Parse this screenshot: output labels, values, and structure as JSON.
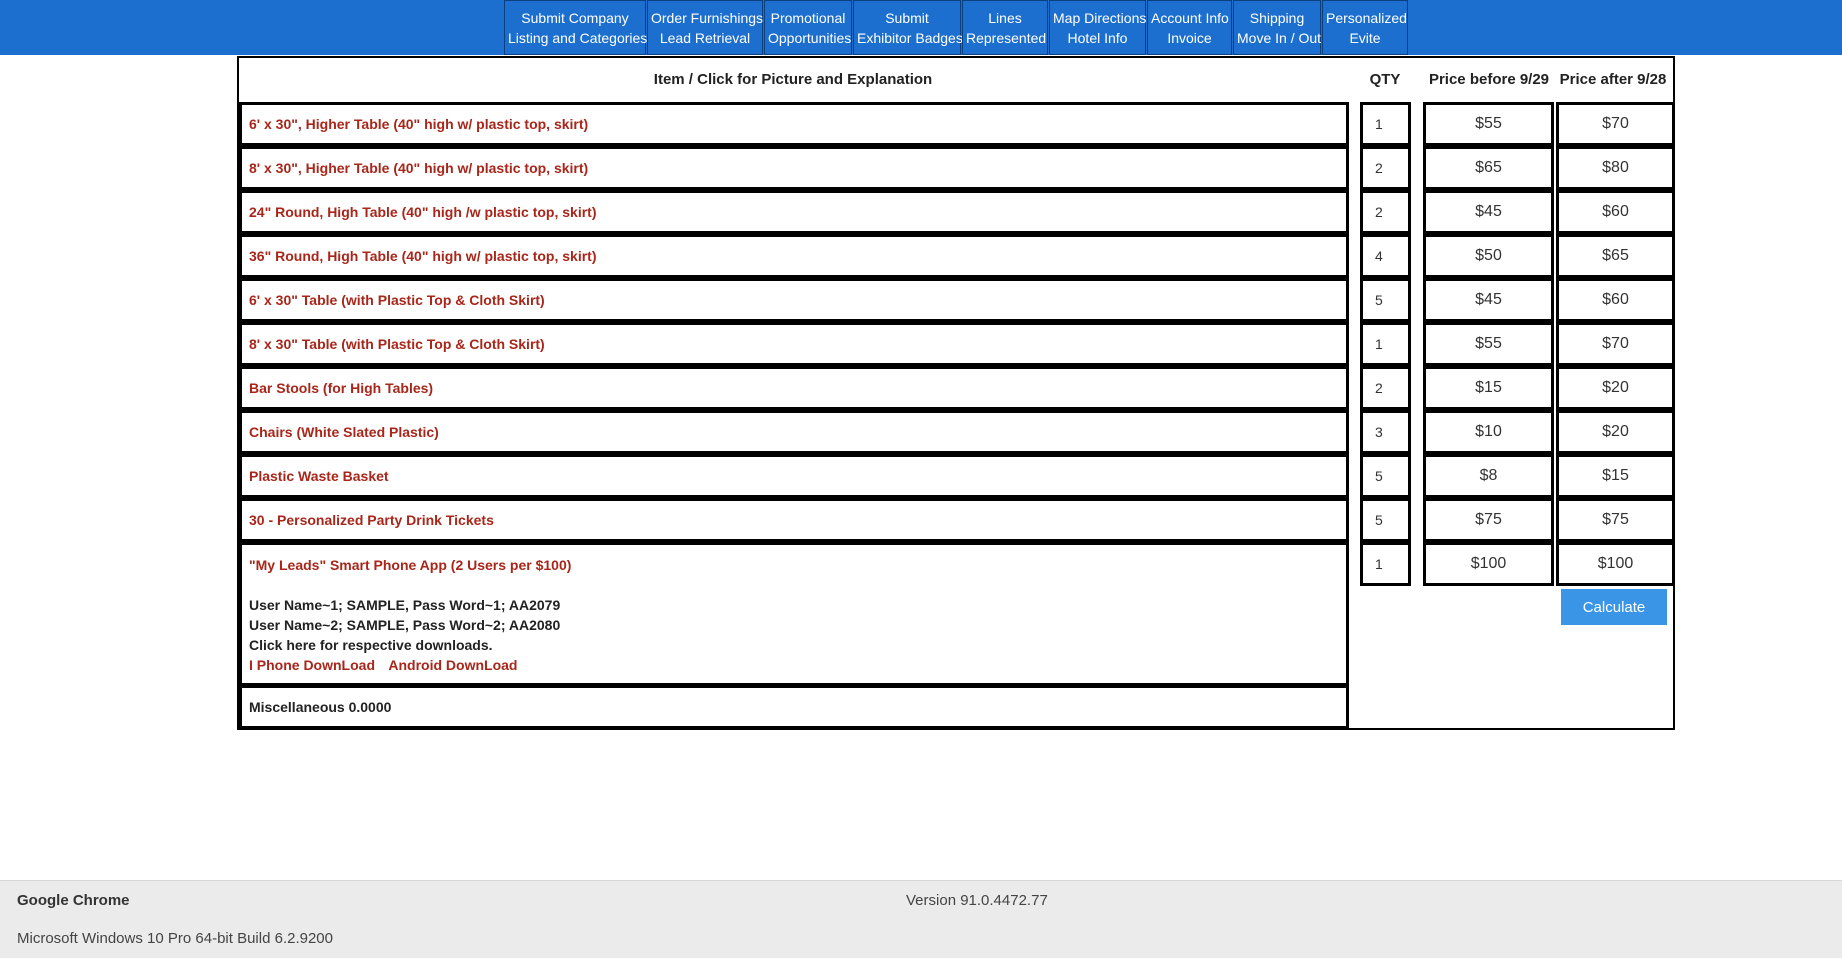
{
  "nav": [
    {
      "line1": "Submit Company",
      "line2": "Listing and Categories"
    },
    {
      "line1": "Order Furnishings",
      "line2": "Lead Retrieval"
    },
    {
      "line1": "Promotional",
      "line2": "Opportunities"
    },
    {
      "line1": "Submit",
      "line2": "Exhibitor Badges"
    },
    {
      "line1": "Lines",
      "line2": "Represented"
    },
    {
      "line1": "Map Directions",
      "line2": "Hotel Info"
    },
    {
      "line1": "Account Info",
      "line2": "Invoice"
    },
    {
      "line1": "Shipping",
      "line2": "Move In / Out"
    },
    {
      "line1": "Personalized",
      "line2": "Evite"
    }
  ],
  "table": {
    "header_item": "Item / Click for Picture and Explanation",
    "header_qty": "QTY",
    "header_price_before": "Price before 9/29",
    "header_price_after": "Price after 9/28",
    "rows": [
      {
        "name": "6' x 30\", Higher Table (40\" high w/ plastic top, skirt)",
        "qty": "1",
        "before": "$55",
        "after": "$70"
      },
      {
        "name": "8' x 30\", Higher Table (40\" high w/ plastic top, skirt)",
        "qty": "2",
        "before": "$65",
        "after": "$80"
      },
      {
        "name": "24\" Round, High Table (40\" high /w plastic top, skirt)",
        "qty": "2",
        "before": "$45",
        "after": "$60"
      },
      {
        "name": "36\" Round, High Table (40\" high w/ plastic top, skirt)",
        "qty": "4",
        "before": "$50",
        "after": "$65"
      },
      {
        "name": "6' x 30\" Table (with Plastic Top & Cloth Skirt)",
        "qty": "5",
        "before": "$45",
        "after": "$60"
      },
      {
        "name": "8' x 30\" Table (with Plastic Top & Cloth Skirt)",
        "qty": "1",
        "before": "$55",
        "after": "$70"
      },
      {
        "name": "Bar Stools (for High Tables)",
        "qty": "2",
        "before": "$15",
        "after": "$20"
      },
      {
        "name": "Chairs (White Slated Plastic)",
        "qty": "3",
        "before": "$10",
        "after": "$20"
      },
      {
        "name": "Plastic Waste Basket",
        "qty": "5",
        "before": "$8",
        "after": "$15"
      },
      {
        "name": "30 - Personalized Party Drink Tickets",
        "qty": "5",
        "before": "$75",
        "after": "$75"
      },
      {
        "name": "\"My Leads\" Smart Phone App (2 Users per $100)",
        "qty": "1",
        "before": "$100",
        "after": "$100"
      }
    ],
    "app_user1": "User Name~1; SAMPLE, Pass Word~1; AA2079",
    "app_user2": "User Name~2; SAMPLE, Pass Word~2; AA2080",
    "app_note": "Click here for respective downloads.",
    "iphone_link": "I Phone DownLoad",
    "android_link": "Android DownLoad",
    "misc": "Miscellaneous 0.0000",
    "calculate_label": "Calculate"
  },
  "footer": {
    "browser": "Google Chrome",
    "version": "Version 91.0.4472.77",
    "os": "Microsoft Windows 10 Pro 64-bit Build 6.2.9200"
  }
}
